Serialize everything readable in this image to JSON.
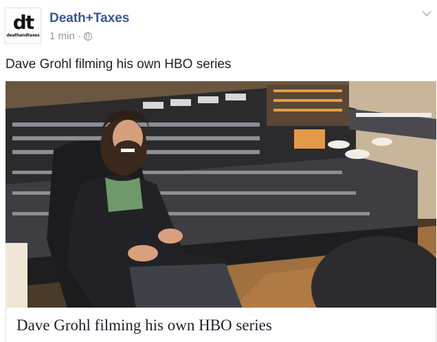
{
  "post": {
    "page_name": "Death+Taxes",
    "avatar_logo": "dt",
    "avatar_sub": "deathandtaxes",
    "timestamp": "1 min",
    "separator": "·",
    "privacy_icon": "globe-icon",
    "menu_icon": "chevron-down-icon",
    "status_text": "Dave Grohl filming his own HBO series",
    "link_title": "Dave Grohl filming his own HBO series"
  },
  "colors": {
    "name": "#365899",
    "meta": "#90949c",
    "text": "#1d2129"
  }
}
